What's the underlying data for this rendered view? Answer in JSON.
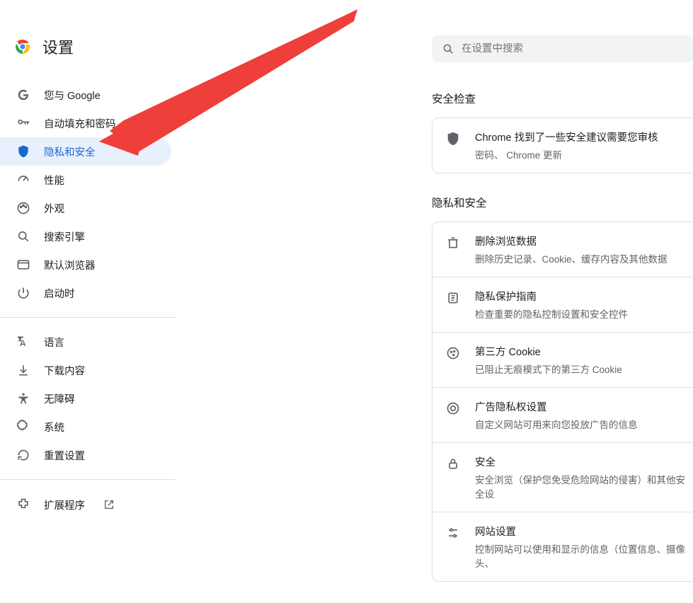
{
  "brand": {
    "title": "设置"
  },
  "search": {
    "placeholder": "在设置中搜索"
  },
  "sidebar": {
    "group1": [
      {
        "label": "您与 Google",
        "icon": "google"
      },
      {
        "label": "自动填充和密码",
        "icon": "key"
      },
      {
        "label": "隐私和安全",
        "icon": "shield",
        "selected": true
      },
      {
        "label": "性能",
        "icon": "speed"
      },
      {
        "label": "外观",
        "icon": "palette"
      },
      {
        "label": "搜索引擎",
        "icon": "search"
      },
      {
        "label": "默认浏览器",
        "icon": "browser"
      },
      {
        "label": "启动时",
        "icon": "power"
      }
    ],
    "group2": [
      {
        "label": "语言",
        "icon": "translate"
      },
      {
        "label": "下载内容",
        "icon": "download"
      },
      {
        "label": "无障碍",
        "icon": "accessibility"
      },
      {
        "label": "系统",
        "icon": "system"
      },
      {
        "label": "重置设置",
        "icon": "reset"
      }
    ],
    "extensions": {
      "label": "扩展程序"
    }
  },
  "sections": {
    "safety_check": {
      "title": "安全检查",
      "row": {
        "title": "Chrome 找到了一些安全建议需要您审核",
        "sub": "密码、 Chrome 更新"
      }
    },
    "privacy": {
      "title": "隐私和安全",
      "rows": [
        {
          "icon": "trash",
          "title": "删除浏览数据",
          "sub": "删除历史记录、Cookie、缓存内容及其他数据"
        },
        {
          "icon": "guide",
          "title": "隐私保护指南",
          "sub": "检查重要的隐私控制设置和安全控件"
        },
        {
          "icon": "cookie",
          "title": "第三方 Cookie",
          "sub": "已阻止无痕模式下的第三方 Cookie"
        },
        {
          "icon": "ads",
          "title": "广告隐私权设置",
          "sub": "自定义网站可用来向您投放广告的信息"
        },
        {
          "icon": "lock",
          "title": "安全",
          "sub": "安全浏览（保护您免受危险网站的侵害）和其他安全设"
        },
        {
          "icon": "sliders",
          "title": "网站设置",
          "sub": "控制网站可以使用和显示的信息（位置信息、摄像头、"
        }
      ]
    }
  }
}
